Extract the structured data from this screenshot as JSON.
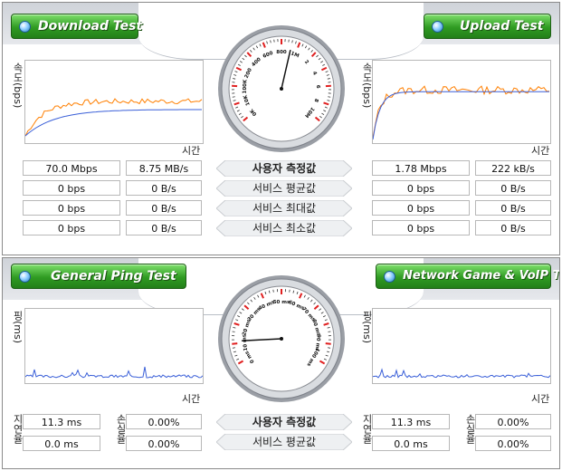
{
  "download": {
    "button_label": "Download Test",
    "y_axis_label": "속도(bps)",
    "x_axis_label": "시간",
    "stats": [
      {
        "bits": "70.0 Mbps",
        "bytes": "8.75 MB/s"
      },
      {
        "bits": "0 bps",
        "bytes": "0 B/s"
      },
      {
        "bits": "0 bps",
        "bytes": "0 B/s"
      },
      {
        "bits": "0 bps",
        "bytes": "0 B/s"
      }
    ]
  },
  "upload": {
    "button_label": "Upload Test",
    "y_axis_label": "속도(bps)",
    "x_axis_label": "시간",
    "stats": [
      {
        "bits": "1.78 Mbps",
        "bytes": "222 kB/s"
      },
      {
        "bits": "0 bps",
        "bytes": "0 B/s"
      },
      {
        "bits": "0 bps",
        "bytes": "0 B/s"
      },
      {
        "bits": "0 bps",
        "bytes": "0 B/s"
      }
    ]
  },
  "speed_gauge": {
    "labels": [
      "0K",
      "10K",
      "100K",
      "200",
      "400",
      "600",
      "800",
      "1M",
      "2",
      "4",
      "6",
      "8",
      "10M"
    ],
    "needle_value": 0.55
  },
  "speed_center": {
    "rows": [
      "사용자 측정값",
      "서비스 평균값",
      "서비스 최대값",
      "서비스 최소값"
    ]
  },
  "ping": {
    "button_label": "General Ping Test",
    "y_axis_label": "핑(ms)",
    "x_axis_label": "시간",
    "latency_label": "지연율",
    "jitter_label": "손실율",
    "latency_values": [
      "11.3 ms",
      "0.0 ms"
    ],
    "loss_values": [
      "0.00%",
      "0.00%"
    ]
  },
  "game": {
    "button_label": "Network Game & VoIP Test",
    "y_axis_label": "핑(ms)",
    "x_axis_label": "시간",
    "latency_label": "지연율",
    "jitter_label": "손실율",
    "latency_values": [
      "11.3 ms",
      "0.0 ms"
    ],
    "loss_values": [
      "0.00%",
      "0.00%"
    ]
  },
  "ping_gauge": {
    "labels": [
      "0 ms",
      "10 ms",
      "20 ms",
      "30 ms",
      "40 ms",
      "50 ms",
      "60 ms",
      "70 ms",
      "80 ms",
      "90 ms",
      "100 ms"
    ],
    "needle_value": 11.3,
    "max": 100
  },
  "ping_center": {
    "rows": [
      "사용자 측정값",
      "서비스 평균값"
    ]
  },
  "colors": {
    "accent_green": "#2f9b22",
    "line_orange": "#ff7f00",
    "line_blue": "#3a5fd8",
    "gauge_red": "#e02020"
  }
}
